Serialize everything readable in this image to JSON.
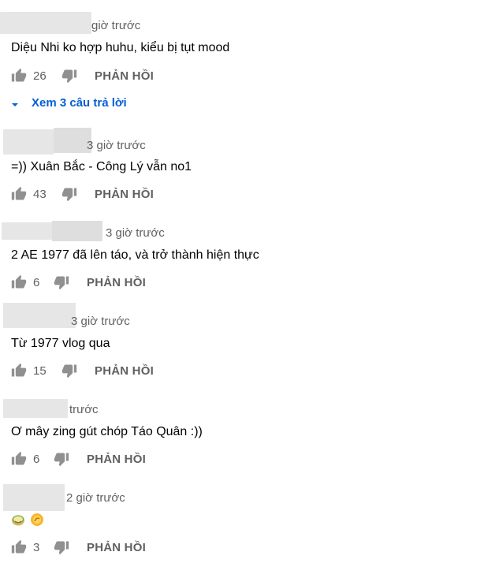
{
  "comments": [
    {
      "time": "giờ trước",
      "text": "Diệu Nhi ko hợp huhu, kiểu bị tụt mood",
      "likes": "26",
      "reply_label": "PHẢN HỒI",
      "view_replies": "Xem 3 câu trả lời"
    },
    {
      "time": "3 giờ trước",
      "text": "=)) Xuân Bắc - Công Lý vẫn no1",
      "likes": "43",
      "reply_label": "PHẢN HỒI"
    },
    {
      "time": "3 giờ trước",
      "text": "2 AE 1977 đã lên táo, và trở thành hiện thực",
      "likes": "6",
      "reply_label": "PHẢN HỒI"
    },
    {
      "time": "3 giờ trước",
      "text": "Từ 1977 vlog qua",
      "likes": "15",
      "reply_label": "PHẢN HỒI"
    },
    {
      "time": "trước",
      "text": "Ơ mây zing gút chóp Táo Quân :))",
      "likes": "6",
      "reply_label": "PHẢN HỒI"
    },
    {
      "time": "2 giờ trước",
      "text": "",
      "emojis": [
        "melon-emoji",
        "beer-emoji"
      ],
      "likes": "3",
      "reply_label": "PHẢN HỒI"
    }
  ],
  "icons": {
    "like": "thumbs-up-icon",
    "dislike": "thumbs-down-icon",
    "expand": "caret-down-icon"
  },
  "colors": {
    "link": "#065fd4",
    "meta": "#606060",
    "text": "#030303",
    "icon": "#909090"
  }
}
